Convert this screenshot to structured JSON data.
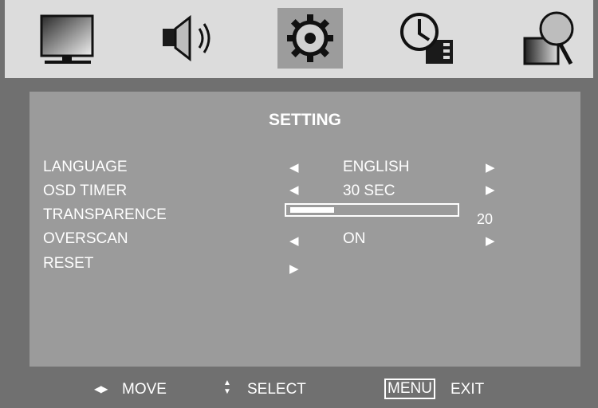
{
  "menu": {
    "tabs": [
      {
        "icon": "monitor-icon"
      },
      {
        "icon": "speaker-icon"
      },
      {
        "icon": "gear-icon",
        "active": true
      },
      {
        "icon": "clock-icon"
      },
      {
        "icon": "magnifier-icon"
      }
    ],
    "title": "SETTING",
    "items": [
      {
        "label": "LANGUAGE",
        "value": "ENGLISH"
      },
      {
        "label": "OSD TIMER",
        "value": "30 SEC"
      },
      {
        "label": "TRANSPARENCE",
        "value": "20",
        "level_percent": 20
      },
      {
        "label": "OVERSCAN",
        "value": "ON"
      },
      {
        "label": "RESET"
      }
    ],
    "arrows": {
      "left": "◀",
      "right": "▶"
    }
  },
  "footer": {
    "move_icon": "◀▶",
    "move": "MOVE",
    "select_icon": "▲▼",
    "select": "SELECT",
    "menu_key": "MENU",
    "exit": "EXIT"
  },
  "colors": {
    "panel": "#9b9b9b",
    "topbar": "#dcdcdc",
    "frame": "#707070",
    "active_tab": "#9c9c9c",
    "text": "#ffffff"
  }
}
